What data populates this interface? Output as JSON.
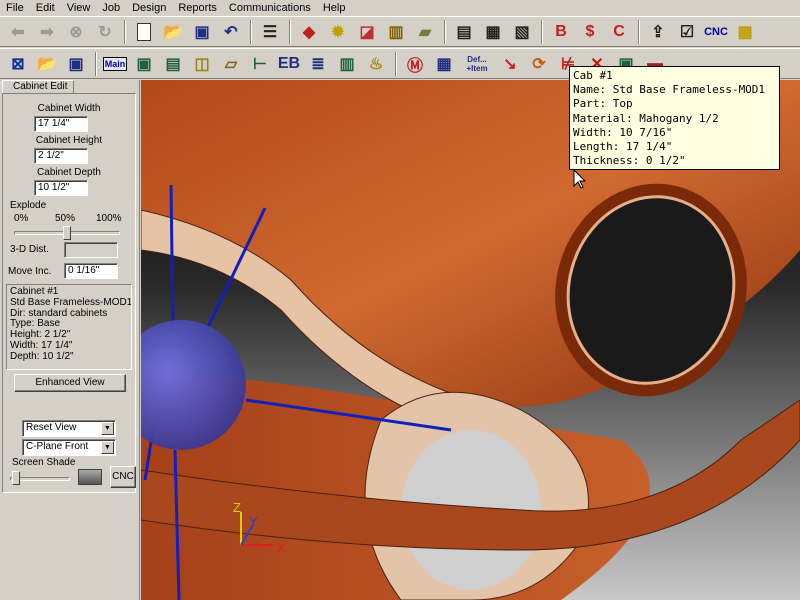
{
  "menubar": {
    "items": [
      "File",
      "Edit",
      "View",
      "Job",
      "Design",
      "Reports",
      "Communications",
      "Help"
    ]
  },
  "toolbar1": {
    "cnc_label": "CNC"
  },
  "toolbar2": {
    "main_label": "Main",
    "def_item_label": "Def... +Item"
  },
  "left_panel": {
    "tab_label": "Cabinet Edit",
    "cabinet_width_label": "Cabinet Width",
    "cabinet_width_value": "17 1/4\"",
    "cabinet_height_label": "Cabinet Height",
    "cabinet_height_value": "2 1/2\"",
    "cabinet_depth_label": "Cabinet Depth",
    "cabinet_depth_value": "10 1/2\"",
    "explode_label": "Explode",
    "explode_ticks": [
      "0%",
      "50%",
      "100%"
    ],
    "explode_value_percent": 50,
    "dist_3d_label": "3-D Dist.",
    "dist_3d_value": "",
    "move_incr_label": "Move Inc.",
    "move_incr_value": "0 1/16\"",
    "info_lines": [
      "Cabinet #1",
      "Std Base Frameless-MOD1",
      "Dir: standard cabinets",
      "Type: Base",
      "Height: 2 1/2\"",
      "Width: 17 1/4\"",
      "Depth: 10 1/2\""
    ],
    "enhanced_view_label": "Enhanced View",
    "reset_view_value": "Reset View",
    "cplane_value": "C-Plane Front",
    "screen_shade_label": "Screen Shade",
    "cnc_button_label": "CNC"
  },
  "viewport": {
    "axis_labels": {
      "x": "X",
      "y": "Y",
      "z": "Z"
    }
  },
  "tooltip": {
    "lines": [
      "Cab #1",
      "Name: Std Base Frameless-MOD1",
      "Part: Top",
      "Material: Mahogany 1/2",
      "Width: 10 7/16\"",
      "Length: 17 1/4\"",
      "Thickness: 0 1/2\""
    ]
  },
  "colors": {
    "wood_dark": "#9c3a10",
    "wood_mid": "#c0602a",
    "wood_light": "#e6c3a4",
    "axis_blue": "#1020c0",
    "sphere": "#5050c8",
    "tooltip_bg": "#ffffe1"
  }
}
